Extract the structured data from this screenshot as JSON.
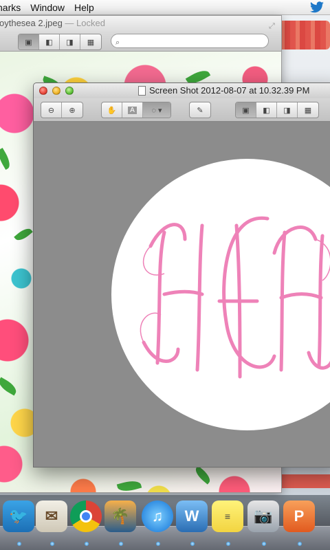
{
  "menubar": {
    "items": [
      "harks",
      "Window",
      "Help"
    ],
    "status_icon": "twitter-bird-icon"
  },
  "back_window": {
    "title": "oythesea 2.jpeg",
    "title_suffix": "— Locked",
    "search_placeholder": ""
  },
  "front_window": {
    "title": "Screen Shot 2012-08-07 at 10.32.39 PM",
    "tools": [
      "zoom-out-icon",
      "zoom-in-icon",
      "hand-icon",
      "text-select-icon",
      "lasso-select-icon",
      "annotate-pen-icon"
    ],
    "view_modes": [
      "content-only-icon",
      "thumbnails-icon",
      "table-of-contents-icon",
      "contact-sheet-icon"
    ]
  },
  "image_content": {
    "monogram": "HCH",
    "monogram_color": "#ee82b8",
    "background_color": "#ffffff"
  },
  "dock": {
    "icons": [
      "twitter",
      "mail",
      "chrome",
      "iphoto",
      "itunes",
      "word",
      "stickies",
      "preview-camera",
      "powerpoint"
    ]
  },
  "colors": {
    "window_chrome": "#d4d4d4",
    "canvas_gray": "#8c8c8c",
    "accent_pink": "#ee82b8"
  }
}
